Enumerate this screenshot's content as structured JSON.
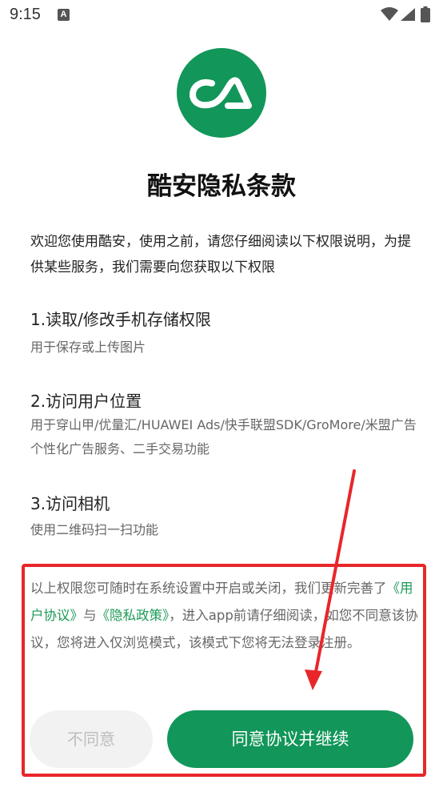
{
  "status_bar": {
    "time": "9:15",
    "notification_letter": "A"
  },
  "colors": {
    "brand_green": "#12965a",
    "link_green": "#1a9a55",
    "highlight_red": "#e8262a"
  },
  "header": {
    "title": "酷安隐私条款"
  },
  "intro": {
    "text": "欢迎您使用酷安，使用之前，请您仔细阅读以下权限说明，为提供某些服务，我们需要向您获取以下权限"
  },
  "permissions": [
    {
      "title": "1.读取/修改手机存储权限",
      "desc": "用于保存或上传图片"
    },
    {
      "title": "2.访问用户位置",
      "desc": "用于穿山甲/优量汇/HUAWEI Ads/快手联盟SDK/GroMore/米盟广告个性化广告服务、二手交易功能"
    },
    {
      "title": "3.访问相机",
      "desc": "使用二维码扫一扫功能"
    }
  ],
  "notice": {
    "part1": "以上权限您可随时在系统设置中开启或关闭，我们更新完善了",
    "link_user_agreement": "《用户协议》",
    "part2": "与",
    "link_privacy_policy": "《隐私政策》",
    "part3": "，进入app前请仔细阅读，如您不同意该协议，您将进入仅浏览模式，该模式下您将无法登录注册。"
  },
  "buttons": {
    "disagree_label": "不同意",
    "agree_label": "同意协议并继续"
  }
}
